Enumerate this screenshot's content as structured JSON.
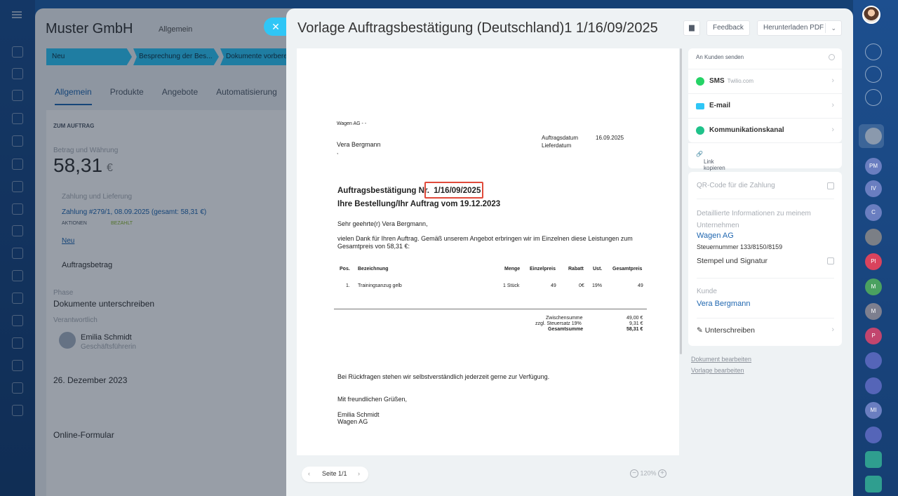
{
  "background": {
    "title": "Muster GmbH",
    "subtitle": "Allgemein",
    "stages": [
      "Neu",
      "Besprechung der Bes...",
      "Dokumente vorbere"
    ],
    "tabs": [
      "Allgemein",
      "Produkte",
      "Angebote",
      "Automatisierung"
    ],
    "section_title": "ZUM AUFTRAG",
    "amount_label": "Betrag und Währung",
    "amount_value": "58,31",
    "amount_currency": "€",
    "payment_label": "Zahlung und Lieferung",
    "payment_text": "Zahlung #279/1, 08.09.2025 (gesamt: 58,31 €)",
    "actions_badge": "AKTIONEN",
    "paid_badge": "BEZAHLT",
    "new_link": "Neu",
    "order_amount_label": "Auftragsbetrag",
    "phase_label": "Phase",
    "phase_value": "Dokumente unterschreiben",
    "responsible_label": "Verantwortlich",
    "person_name": "Emilia Schmidt",
    "person_role": "Geschäftsführerin",
    "date_value": "26. Dezember 2023",
    "source_value": "Online-Formular"
  },
  "modal": {
    "title": "Vorlage Auftragsbestätigung (Deutschland)1 1/16/09/2025",
    "feedback_label": "Feedback",
    "download_label": "Herunterladen PDF"
  },
  "document": {
    "sender_line": "Wagen AG -  -",
    "recipient": "Vera Bergmann",
    "recipient_extra": ",",
    "order_date_label": "Auftragsdatum",
    "order_date_value": "16.09.2025",
    "delivery_date_label": "Lieferdatum",
    "heading_prefix": "Auftragsbestätigung Nr.",
    "heading_number": "1/16/09/2025",
    "subheading": "Ihre Bestellung/Ihr Auftrag vom 19.12.2023",
    "greeting": "Sehr geehrte(r) Vera Bergmann,",
    "intro_line1": "vielen Dank für Ihren Auftrag. Gemäß unserem Angebot erbringen wir im Einzelnen diese Leistungen zum",
    "intro_line2": "Gesamtpreis von 58,31 €:",
    "table_headers": [
      "Pos.",
      "Bezeichnung",
      "Menge",
      "Einzelpreis",
      "Rabatt",
      "Ust.",
      "Gesamtpreis"
    ],
    "table_row": [
      "1.",
      "Trainingsanzug gelb",
      "1 Stück",
      "49",
      "0€",
      "19%",
      "49"
    ],
    "subtotal_label": "Zwischensumme",
    "subtotal_value": "49,00 €",
    "tax_label": "zzgl. Steuersatz 19%",
    "tax_value": "9,31 €",
    "total_label": "Gesamtsumme",
    "total_value": "58,31 €",
    "closing_question": "Bei Rückfragen stehen wir selbstverständlich jederzeit gerne zur Verfügung.",
    "regards": "Mit freundlichen Grüßen,",
    "signer": "Emilia Schmidt",
    "company": "Wagen AG"
  },
  "pager": {
    "label": "Seite 1/1",
    "zoom": "120%"
  },
  "send": {
    "header": "An Kunden senden",
    "sms_label": "SMS",
    "sms_provider": "Twilio.com",
    "email_label": "E-mail",
    "channel_label": "Kommunikationskanal",
    "copy_link": "Link kopieren"
  },
  "info": {
    "qr_label": "QR-Code für die Zahlung",
    "company_info_label": "Detaillierte Informationen zu meinem Unternehmen",
    "company_name": "Wagen AG",
    "tax_number": "Steuernummer 133/8150/8159",
    "stamp_label": "Stempel und Signatur",
    "customer_label": "Kunde",
    "customer_name": "Vera Bergmann",
    "sign_label": "Unterschreiben"
  },
  "footer_links": [
    "Dokument bearbeiten",
    "Vorlage bearbeiten"
  ],
  "right_rail": [
    "PM",
    "IV",
    "C",
    "PI",
    "M",
    "M",
    "P",
    "MI"
  ],
  "colors": {
    "accent": "#2fc6f6",
    "link": "#2067b0",
    "highlight": "#e04a3b",
    "sms_green": "#25d366",
    "email_blue": "#2fc6f6",
    "channel_teal": "#1fc28a"
  }
}
